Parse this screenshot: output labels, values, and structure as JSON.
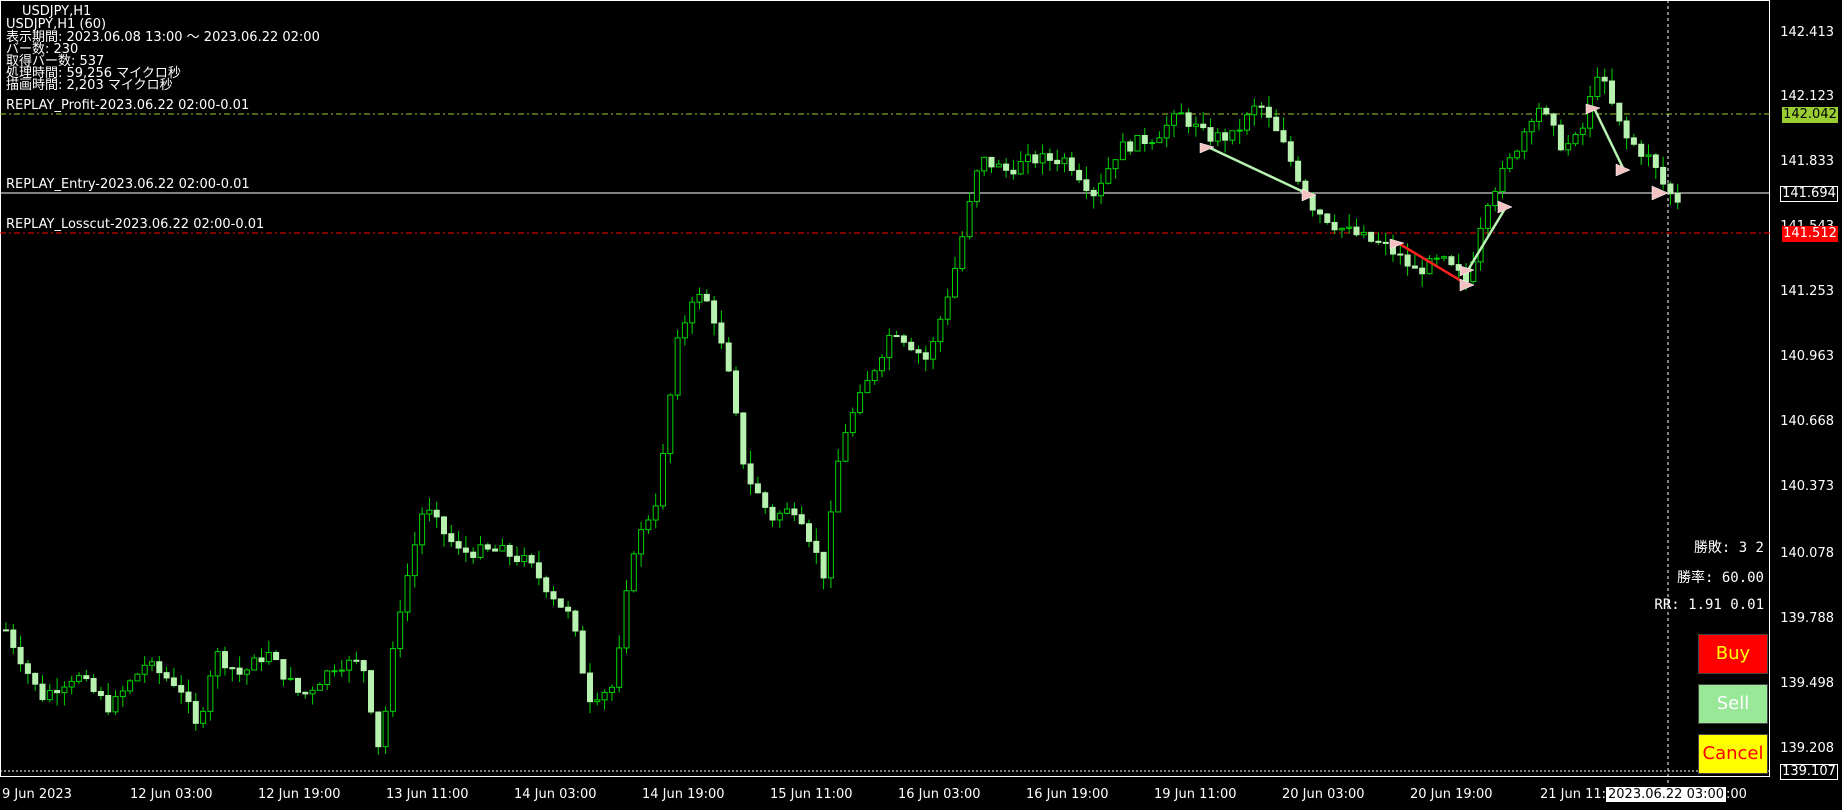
{
  "header": {
    "symbol_line": "USDJPY,H1",
    "info_lines": [
      "USDJPY,H1 (60)",
      "表示期間: 2023.06.08 13:00 ～ 2023.06.22 02:00",
      "バー数: 230",
      "取得バー数: 537",
      "処理時間: 59,256 マイクロ秒",
      "描画時間: 2,203 マイクロ秒"
    ]
  },
  "lines": {
    "profit_label": "REPLAY_Profit-2023.06.22 02:00-0.01",
    "entry_label": "REPLAY_Entry-2023.06.22 02:00-0.01",
    "losscut_label": "REPLAY_Losscut-2023.06.22 02:00-0.01"
  },
  "price_axis": {
    "ticks": [
      "142.413",
      "142.123",
      "141.833",
      "141.543",
      "141.253",
      "140.963",
      "140.668",
      "140.373",
      "140.078",
      "139.788",
      "139.498",
      "139.208"
    ],
    "profit_price": "142.042",
    "entry_price": "141.694",
    "losscut_price": "141.512",
    "bottom_price": "139.107"
  },
  "time_axis": {
    "labels": [
      "9 Jun 2023",
      "12 Jun 03:00",
      "12 Jun 19:00",
      "13 Jun 11:00",
      "14 Jun 03:00",
      "14 Jun 19:00",
      "15 Jun 11:00",
      "16 Jun 03:00",
      "16 Jun 19:00",
      "19 Jun 11:00",
      "20 Jun 03:00",
      "20 Jun 19:00",
      "21 Jun 11:"
    ],
    "cursor_time": "2023.06.22 03:00",
    "cursor_suffix": ":00"
  },
  "stats": {
    "wins_losses": "勝敗: 3 2",
    "win_rate": "勝率: 60.00",
    "rr": "RR: 1.91 0.01"
  },
  "buttons": {
    "buy": "Buy",
    "sell": "Sell",
    "cancel": "Cancel"
  },
  "colors": {
    "bull": "#b8f2b0",
    "bear": "#00d400",
    "profit_line": "#9acd32",
    "entry_line": "#ffffff",
    "losscut_line": "#ff0000",
    "buy_btn": "#ff0000",
    "sell_btn": "#98e898",
    "cancel_btn": "#ffff00"
  },
  "chart_data": {
    "type": "candlestick",
    "title": "USDJPY,H1",
    "ylim": [
      139.107,
      142.5
    ],
    "x_range": [
      "2023.06.08 13:00",
      "2023.06.22 02:00"
    ],
    "series": [
      {
        "name": "USDJPY H1",
        "values": []
      }
    ]
  }
}
